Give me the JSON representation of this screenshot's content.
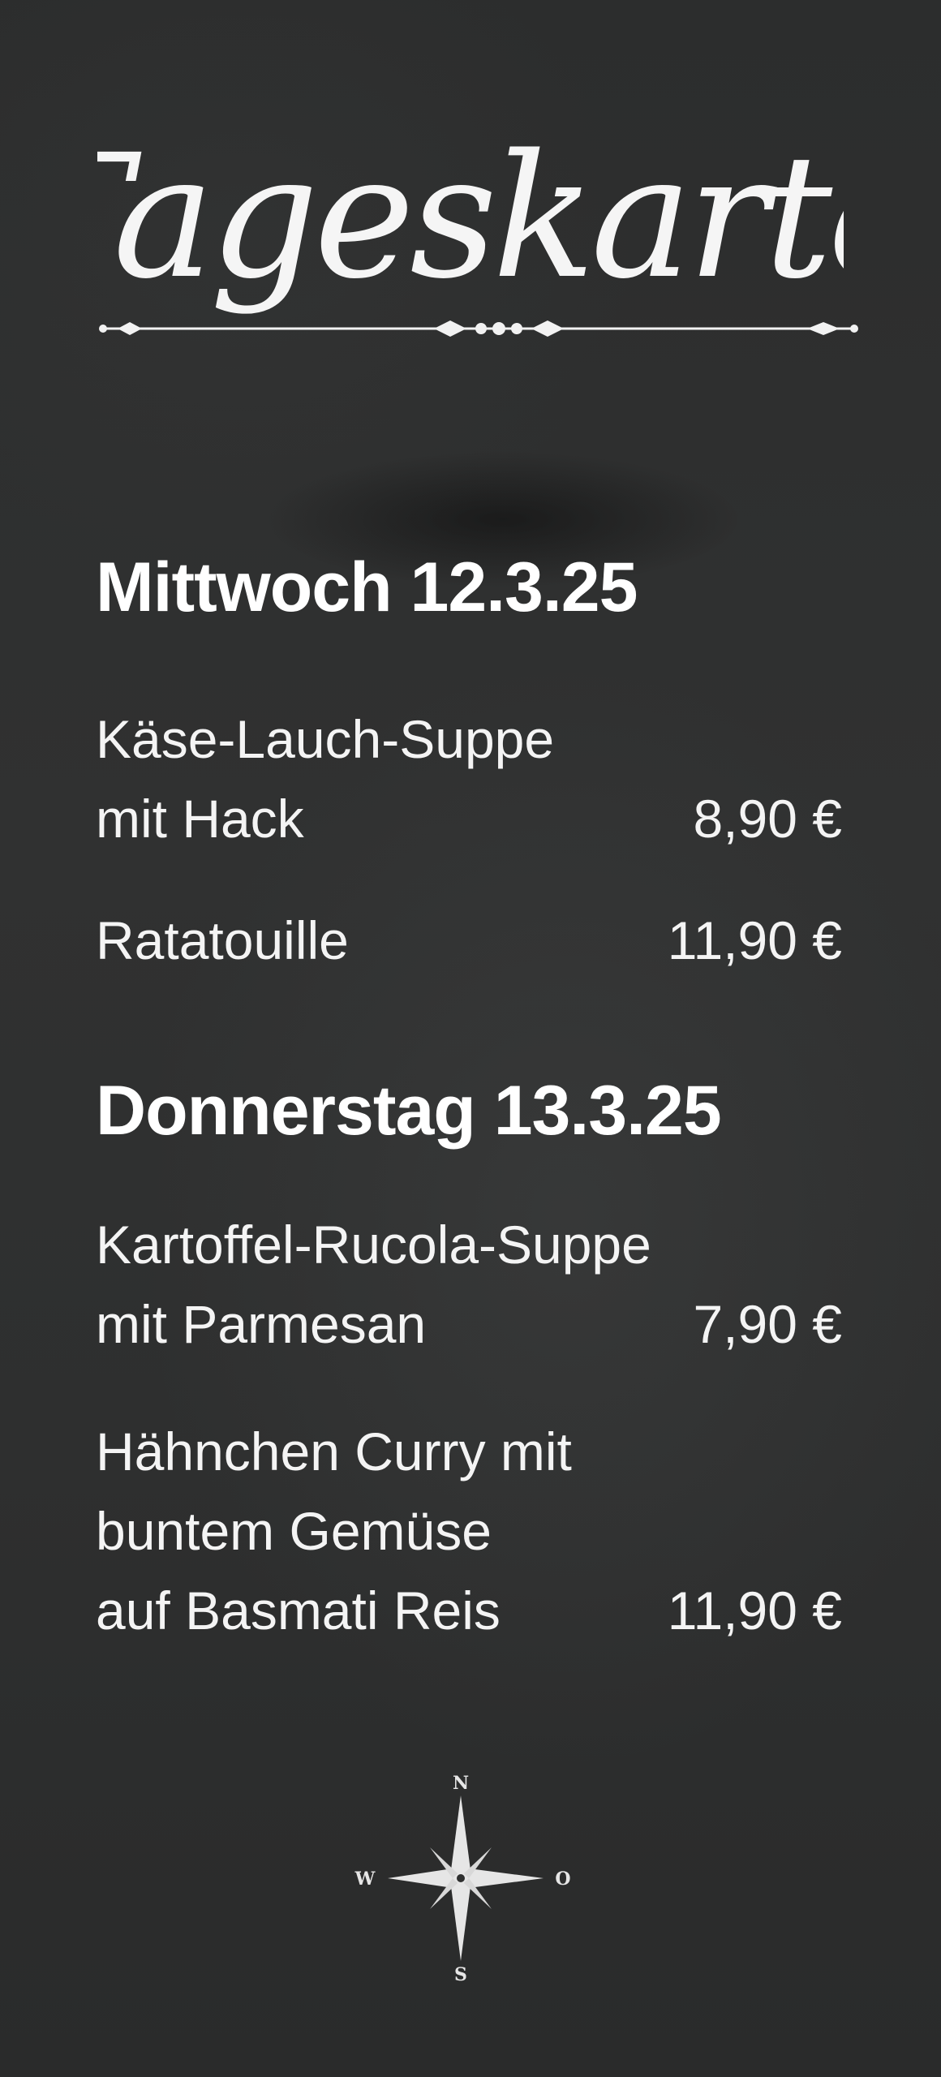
{
  "board": {
    "title": "Tageskarte",
    "days": [
      {
        "heading": "Mittwoch 12.3.25",
        "dishes": [
          {
            "lines": [
              "Käse-Lauch-Suppe",
              "mit Hack"
            ],
            "price": "8,90 €"
          },
          {
            "lines": [
              "Ratatouille"
            ],
            "price": "11,90 €"
          }
        ]
      },
      {
        "heading": "Donnerstag 13.3.25",
        "dishes": [
          {
            "lines": [
              "Kartoffel-Rucola-Suppe",
              "mit Parmesan"
            ],
            "price": "7,90 €"
          },
          {
            "lines": [
              "Hähnchen Curry mit",
              "buntem Gemüse",
              "auf Basmati Reis"
            ],
            "price": "11,90 €"
          }
        ]
      }
    ],
    "compass": {
      "north": "N",
      "west": "W",
      "east": "O",
      "south": "S",
      "icon": "compass-rose-icon"
    }
  },
  "colors": {
    "chalkboard": "#2e2f2f",
    "chalk": "#ffffff"
  }
}
